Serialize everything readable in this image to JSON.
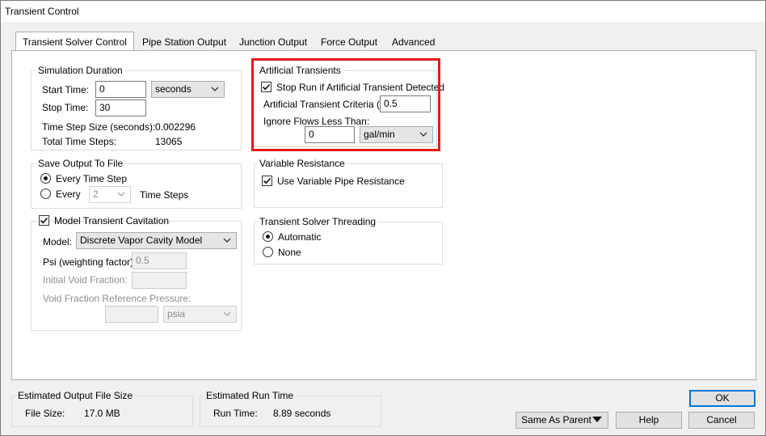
{
  "window": {
    "title": "Transient Control"
  },
  "tabs": [
    {
      "label": "Transient Solver Control",
      "active": true
    },
    {
      "label": "Pipe Station Output"
    },
    {
      "label": "Junction Output"
    },
    {
      "label": "Force Output"
    },
    {
      "label": "Advanced"
    }
  ],
  "simulation_duration": {
    "title": "Simulation Duration",
    "start_time_label": "Start Time:",
    "start_time_value": "0",
    "start_time_unit": "seconds",
    "stop_time_label": "Stop Time:",
    "stop_time_value": "30",
    "time_step_label": "Time Step Size (seconds):",
    "time_step_value": "0.002296",
    "total_steps_label": "Total Time Steps:",
    "total_steps_value": "13065"
  },
  "save_output": {
    "title": "Save Output To File",
    "every_time_step_label": "Every Time Step",
    "every_time_step_selected": true,
    "every_label": "Every",
    "every_value": "2",
    "time_steps_label": "Time Steps"
  },
  "cavitation": {
    "title": "Model Transient Cavitation",
    "checked": true,
    "model_label": "Model:",
    "model_value": "Discrete Vapor Cavity Model",
    "psi_label": "Psi (weighting factor):",
    "psi_value": "0.5",
    "initial_void_label": "Initial Void Fraction:",
    "initial_void_value": "",
    "void_ref_pressure_label": "Void Fraction Reference Pressure:",
    "void_ref_pressure_value": "",
    "void_ref_pressure_unit": "psia"
  },
  "artificial_transients": {
    "title": "Artificial Transients",
    "stop_run_label": "Stop Run if Artificial Transient Detected",
    "stop_run_checked": true,
    "criteria_label": "Artificial Transient Criteria (%):",
    "criteria_value": "0.5",
    "ignore_flows_label": "Ignore Flows Less Than:",
    "ignore_flows_value": "0",
    "ignore_flows_unit": "gal/min",
    "highlight_color": "#e21b1b"
  },
  "variable_resistance": {
    "title": "Variable Resistance",
    "use_label": "Use Variable Pipe Resistance",
    "checked": true
  },
  "threading": {
    "title": "Transient Solver Threading",
    "automatic_label": "Automatic",
    "automatic_selected": true,
    "none_label": "None"
  },
  "estimated_size": {
    "title": "Estimated Output File Size",
    "label": "File Size:",
    "value": "17.0 MB"
  },
  "estimated_runtime": {
    "title": "Estimated Run Time",
    "label": "Run Time:",
    "value": "8.89 seconds"
  },
  "buttons": {
    "ok": "OK",
    "same_as_parent": "Same As Parent",
    "help": "Help",
    "cancel": "Cancel"
  },
  "colors": {
    "default_button_border": "#0078d7",
    "dialog_background": "#f0f0f0"
  }
}
